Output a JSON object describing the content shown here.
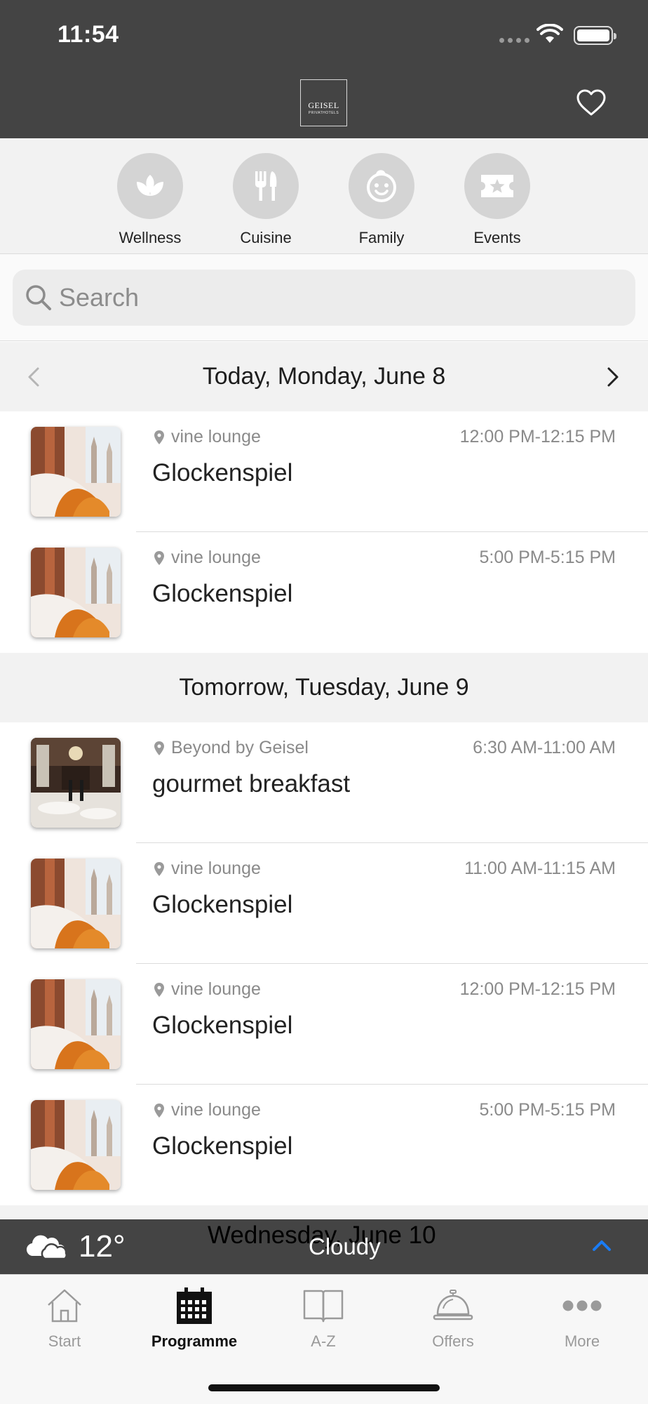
{
  "status": {
    "time": "11:54"
  },
  "header": {
    "logo_line1": "GEISEL",
    "logo_line2": "PRIVATHOTELS"
  },
  "categories": [
    {
      "label": "Wellness",
      "icon": "lotus-icon"
    },
    {
      "label": "Cuisine",
      "icon": "fork-knife-icon"
    },
    {
      "label": "Family",
      "icon": "smiley-icon"
    },
    {
      "label": "Events",
      "icon": "ticket-star-icon"
    }
  ],
  "search": {
    "placeholder": "Search"
  },
  "days": [
    {
      "label": "Today, Monday, June 8",
      "events": [
        {
          "location": "vine lounge",
          "time": "12:00 PM-12:15 PM",
          "title": "Glockenspiel",
          "image": "lounge"
        },
        {
          "location": "vine lounge",
          "time": "5:00 PM-5:15 PM",
          "title": "Glockenspiel",
          "image": "lounge"
        }
      ]
    },
    {
      "label": "Tomorrow, Tuesday, June 9",
      "events": [
        {
          "location": "Beyond by Geisel",
          "time": "6:30 AM-11:00 AM",
          "title": "gourmet breakfast",
          "image": "restaurant"
        },
        {
          "location": "vine lounge",
          "time": "11:00 AM-11:15 AM",
          "title": "Glockenspiel",
          "image": "lounge"
        },
        {
          "location": "vine lounge",
          "time": "12:00 PM-12:15 PM",
          "title": "Glockenspiel",
          "image": "lounge"
        },
        {
          "location": "vine lounge",
          "time": "5:00 PM-5:15 PM",
          "title": "Glockenspiel",
          "image": "lounge"
        }
      ]
    },
    {
      "label": "Wednesday, June 10",
      "events": []
    }
  ],
  "weather": {
    "temp": "12°",
    "condition": "Cloudy",
    "icon": "cloudy-icon"
  },
  "tabs": [
    {
      "label": "Start",
      "icon": "house-icon",
      "active": false
    },
    {
      "label": "Programme",
      "icon": "calendar-icon",
      "active": true
    },
    {
      "label": "A-Z",
      "icon": "book-icon",
      "active": false
    },
    {
      "label": "Offers",
      "icon": "service-bell-icon",
      "active": false
    },
    {
      "label": "More",
      "icon": "more-dots-icon",
      "active": false
    }
  ],
  "colors": {
    "header_bg": "#444444",
    "accent": "#1a7cf5",
    "category_circle": "#d4d4d4"
  }
}
